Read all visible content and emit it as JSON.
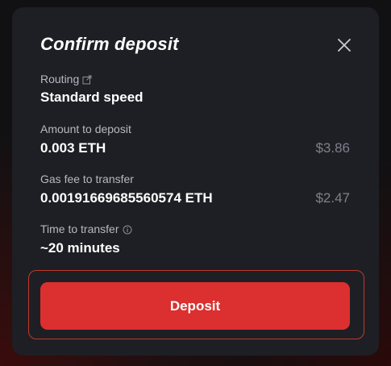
{
  "modal": {
    "title": "Confirm deposit",
    "close_icon": "close-icon"
  },
  "routing": {
    "label": "Routing",
    "icon": "external-link-icon",
    "value": "Standard speed"
  },
  "amount": {
    "label": "Amount to deposit",
    "value": "0.003 ETH",
    "usd": "$3.86"
  },
  "gas_fee": {
    "label": "Gas fee to transfer",
    "value": "0.00191669685560574 ETH",
    "usd": "$2.47"
  },
  "time": {
    "label": "Time to transfer",
    "icon": "info-icon",
    "value": "~20 minutes"
  },
  "deposit_button": {
    "label": "Deposit"
  },
  "colors": {
    "accent": "#dc2f2f",
    "modal_bg": "#1e1f24",
    "focus_ring": "#c0392b"
  }
}
